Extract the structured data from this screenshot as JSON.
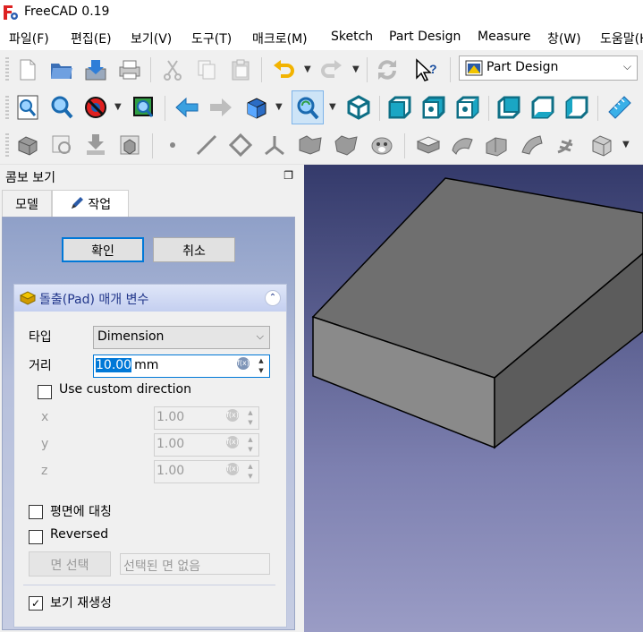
{
  "window": {
    "title": "FreeCAD 0.19",
    "app_icon": "freecad-logo-icon"
  },
  "menu": [
    "파일(F)",
    "편집(E)",
    "보기(V)",
    "도구(T)",
    "매크로(M)",
    "Sketch",
    "Part Design",
    "Measure",
    "창(W)",
    "도움말(H)"
  ],
  "workbench": {
    "selected": "Part Design",
    "icon": "part-design-workbench-icon"
  },
  "toolbars": {
    "file_edit": [
      "new-document-icon",
      "open-icon",
      "save-icon",
      "print-icon",
      "cut-icon",
      "copy-icon",
      "paste-icon",
      "undo-icon",
      "redo-icon",
      "refresh-icon",
      "whats-this-icon"
    ],
    "view": [
      "fit-all-icon",
      "fit-selection-icon",
      "draw-style-icon",
      "bounding-box-icon",
      "back-icon",
      "forward-icon",
      "std-views-icon",
      "zoom-views-icon",
      "isometric-view-icon",
      "front-view-icon",
      "top-view-icon",
      "right-view-icon",
      "rear-view-icon",
      "bottom-view-icon",
      "left-view-icon",
      "measure-distance-icon"
    ],
    "part_design": [
      "create-body-icon",
      "create-sketch-icon",
      "validate-sketch-icon",
      "shape-binder-icon",
      "datum-point-icon",
      "datum-line-icon",
      "datum-plane-icon",
      "local-coordinate-system-icon",
      "sub-shape-binder-icon",
      "clone-icon",
      "sheep-icon",
      "pad-icon",
      "revolution-icon",
      "loft-icon",
      "sweep-icon",
      "helix-icon",
      "additive-primitive-icon"
    ]
  },
  "combo_view": {
    "title": "콤보 보기",
    "tabs": {
      "model": "모델",
      "task": "작업"
    },
    "buttons": {
      "ok": "확인",
      "cancel": "취소"
    },
    "pad_params": {
      "title": "돌출(Pad) 매개 변수",
      "type_label": "타입",
      "type_value": "Dimension",
      "length_label": "거리",
      "length_value": "10.00",
      "length_unit": "mm",
      "custom_dir_label": "Use custom direction",
      "custom_dir_checked": false,
      "x_label": "x",
      "x_value": "1.00",
      "y_label": "y",
      "y_value": "1.00",
      "z_label": "z",
      "z_value": "1.00",
      "symmetric_label": "평면에 대칭",
      "symmetric_checked": false,
      "reversed_label": "Reversed",
      "reversed_checked": false,
      "select_face_button": "면 선택",
      "select_face_placeholder": "선택된 면 없음",
      "update_view_label": "보기 재생성",
      "update_view_checked": true
    }
  },
  "viewport": {
    "object": "pad-box-solid",
    "colors": {
      "top": "#6e6e6e",
      "front": "#8a8a8a",
      "side": "#5a5a5a",
      "edge": "#000000"
    }
  }
}
